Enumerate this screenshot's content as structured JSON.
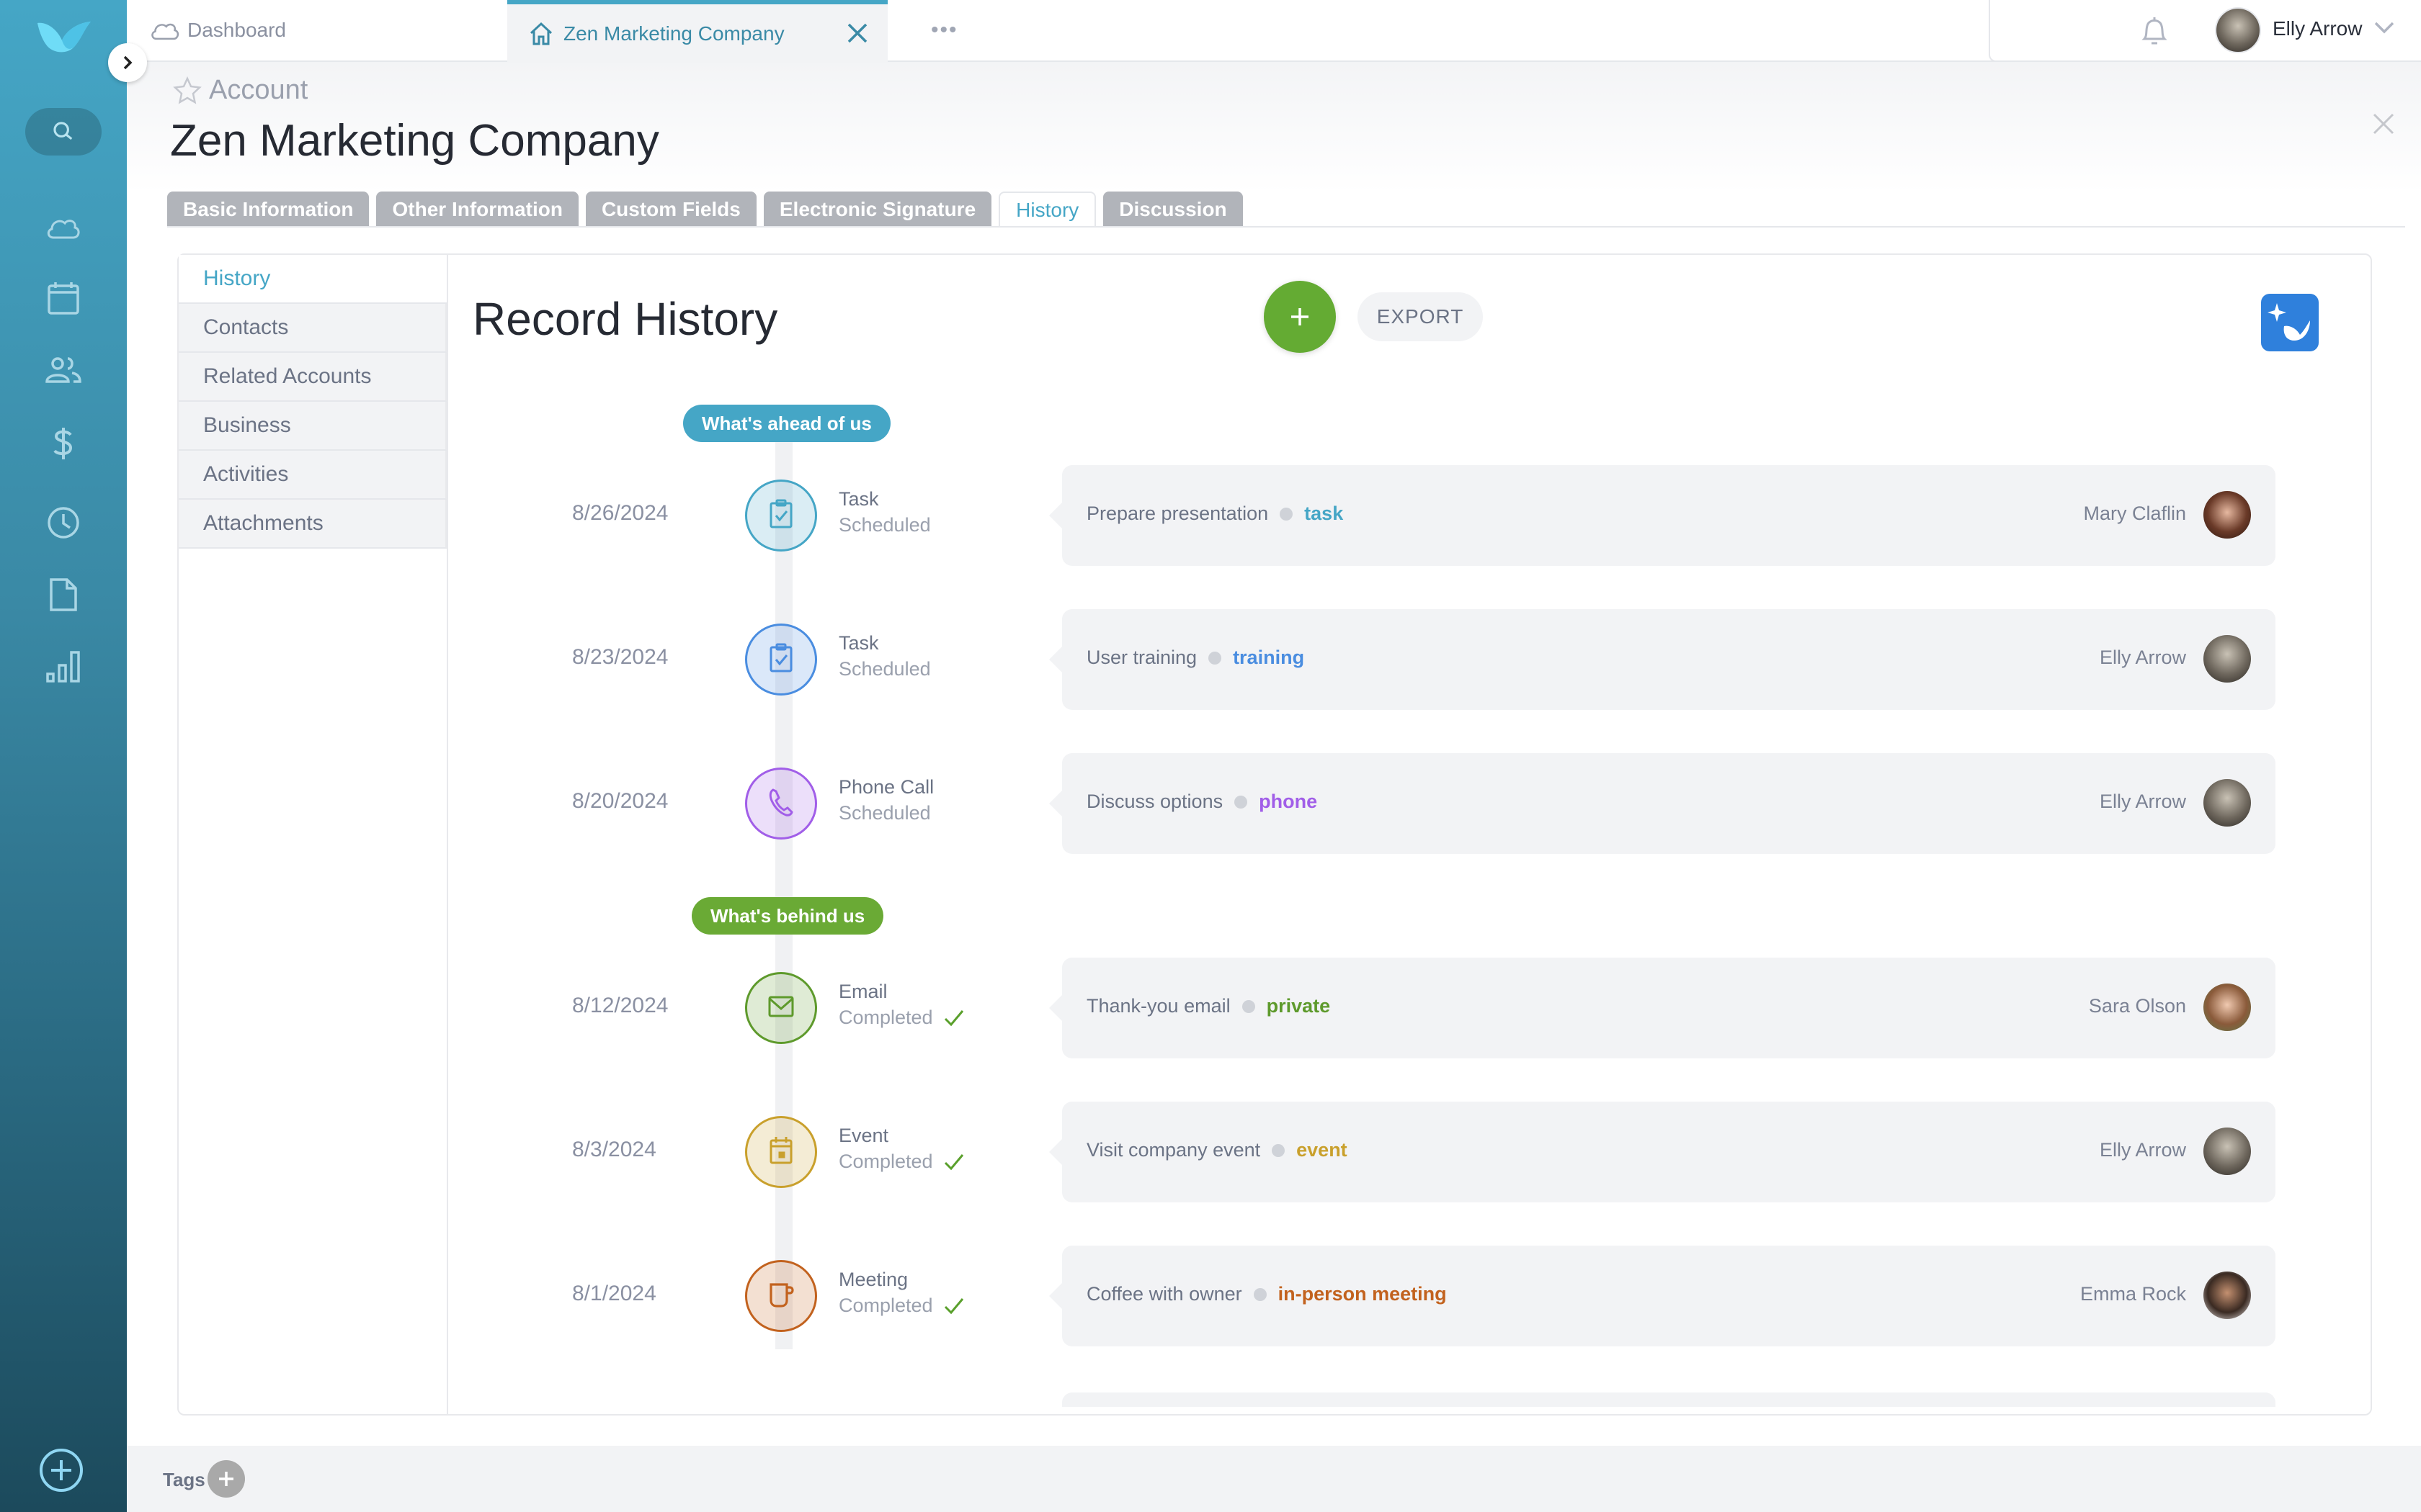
{
  "nav": {
    "items": [
      {
        "name": "cloud",
        "icon": "cloud-icon"
      },
      {
        "name": "calendar",
        "icon": "calendar-icon"
      },
      {
        "name": "contacts",
        "icon": "people-icon"
      },
      {
        "name": "sales",
        "icon": "dollar-icon"
      },
      {
        "name": "history",
        "icon": "clock-icon"
      },
      {
        "name": "documents",
        "icon": "document-icon"
      },
      {
        "name": "reports",
        "icon": "bar-chart-icon"
      }
    ]
  },
  "tabs": {
    "dashboard_label": "Dashboard",
    "active_label": "Zen Marketing Company",
    "more_label": "•••"
  },
  "user": {
    "name": "Elly Arrow"
  },
  "record": {
    "type": "Account",
    "title": "Zen Marketing Company"
  },
  "record_tabs": [
    "Basic Information",
    "Other Information",
    "Custom Fields",
    "Electronic Signature",
    "History",
    "Discussion"
  ],
  "active_record_tab": "History",
  "subnav": [
    "History",
    "Contacts",
    "Related Accounts",
    "Business",
    "Activities",
    "Attachments"
  ],
  "history": {
    "title": "Record History",
    "export_label": "EXPORT",
    "ahead_label": "What's ahead of us",
    "behind_label": "What's behind us",
    "upcoming": [
      {
        "date": "8/26/2024",
        "type": "Task",
        "status": "Scheduled",
        "subject": "Prepare presentation",
        "tag": "task",
        "owner": "Mary Claflin",
        "icon": "clipboard-check-icon",
        "color": "#45a6c6"
      },
      {
        "date": "8/23/2024",
        "type": "Task",
        "status": "Scheduled",
        "subject": "User training",
        "tag": "training",
        "owner": "Elly Arrow",
        "icon": "clipboard-check-icon",
        "color": "#4a8de0"
      },
      {
        "date": "8/20/2024",
        "type": "Phone Call",
        "status": "Scheduled",
        "subject": "Discuss options",
        "tag": "phone",
        "owner": "Elly Arrow",
        "icon": "phone-icon",
        "color": "#a15ee8"
      }
    ],
    "past": [
      {
        "date": "8/12/2024",
        "type": "Email",
        "status": "Completed",
        "subject": "Thank-you email",
        "tag": "private",
        "owner": "Sara Olson",
        "icon": "envelope-icon",
        "color": "#5e9a2c"
      },
      {
        "date": "8/3/2024",
        "type": "Event",
        "status": "Completed",
        "subject": "Visit company event",
        "tag": "event",
        "owner": "Elly Arrow",
        "icon": "calendar-icon",
        "color": "#c9a02c"
      },
      {
        "date": "8/1/2024",
        "type": "Meeting",
        "status": "Completed",
        "subject": "Coffee with owner",
        "tag": "in-person meeting",
        "owner": "Emma Rock",
        "icon": "coffee-cup-icon",
        "color": "#c2621e"
      }
    ]
  },
  "footer": {
    "tags_label": "Tags"
  }
}
